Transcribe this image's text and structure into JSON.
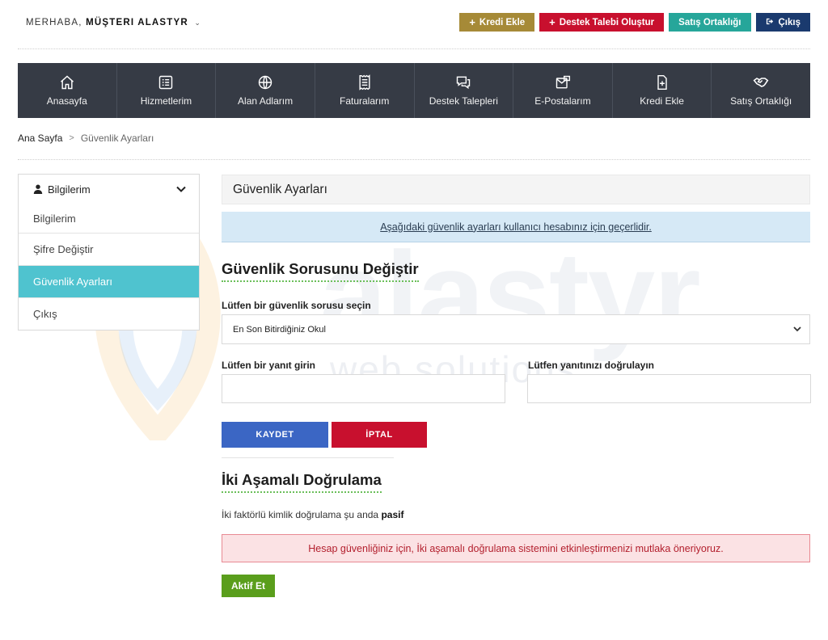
{
  "topbar": {
    "greeting_prefix": "MERHABA,",
    "greeting_name": "MÜŞTERI ALASTYR",
    "buttons": [
      {
        "label": "Kredi Ekle",
        "icon": "plus-icon",
        "color": "#a68a37"
      },
      {
        "label": "Destek Talebi Oluştur",
        "icon": "plus-icon",
        "color": "#c8102e"
      },
      {
        "label": "Satış Ortaklığı",
        "icon": "",
        "color": "#26a69a"
      },
      {
        "label": "Çıkış",
        "icon": "logout-icon",
        "color": "#1a3a6e"
      }
    ]
  },
  "nav": {
    "items": [
      {
        "label": "Anasayfa",
        "icon": "home-icon"
      },
      {
        "label": "Hizmetlerim",
        "icon": "list-icon"
      },
      {
        "label": "Alan Adlarım",
        "icon": "globe-icon"
      },
      {
        "label": "Faturalarım",
        "icon": "invoice-icon"
      },
      {
        "label": "Destek Talepleri",
        "icon": "chat-icon"
      },
      {
        "label": "E-Postalarım",
        "icon": "mail-icon"
      },
      {
        "label": "Kredi Ekle",
        "icon": "file-plus-icon"
      },
      {
        "label": "Satış Ortaklığı",
        "icon": "handshake-icon"
      }
    ]
  },
  "breadcrumb": {
    "home": "Ana Sayfa",
    "separator": ">",
    "current": "Güvenlik Ayarları"
  },
  "sidebar": {
    "header": "Bilgilerim",
    "items": [
      {
        "label": "Bilgilerim",
        "active": false
      },
      {
        "label": "Şifre Değiştir",
        "active": false
      },
      {
        "label": "Güvenlik Ayarları",
        "active": true
      },
      {
        "label": "Çıkış",
        "active": false
      }
    ],
    "active_color": "#4fc3cf"
  },
  "main": {
    "page_title": "Güvenlik Ayarları",
    "info": "Aşağıdaki güvenlik ayarları kullanıcı hesabınız için geçerlidir.",
    "question_section": {
      "title": "Güvenlik Sorusunu Değiştir",
      "question_label": "Lütfen bir güvenlik sorusu seçin",
      "question_value": "En Son Bitirdiğiniz Okul",
      "answer_label": "Lütfen bir yanıt girin",
      "answer_value": "",
      "confirm_label": "Lütfen yanıtınızı doğrulayın",
      "confirm_value": "",
      "save_label": "KAYDET",
      "cancel_label": "İPTAL"
    },
    "two_factor": {
      "title": "İki Aşamalı Doğrulama",
      "status_text": "İki faktörlü kimlik doğrulama şu anda",
      "status_value": "pasif",
      "alert": "Hesap güvenliğiniz için, İki aşamalı doğrulama sistemini etkinleştirmenizi mutlaka öneriyoruz.",
      "activate_label": "Aktif Et"
    }
  },
  "watermark": {
    "brand": "alastyr",
    "tagline": "web solutions"
  }
}
